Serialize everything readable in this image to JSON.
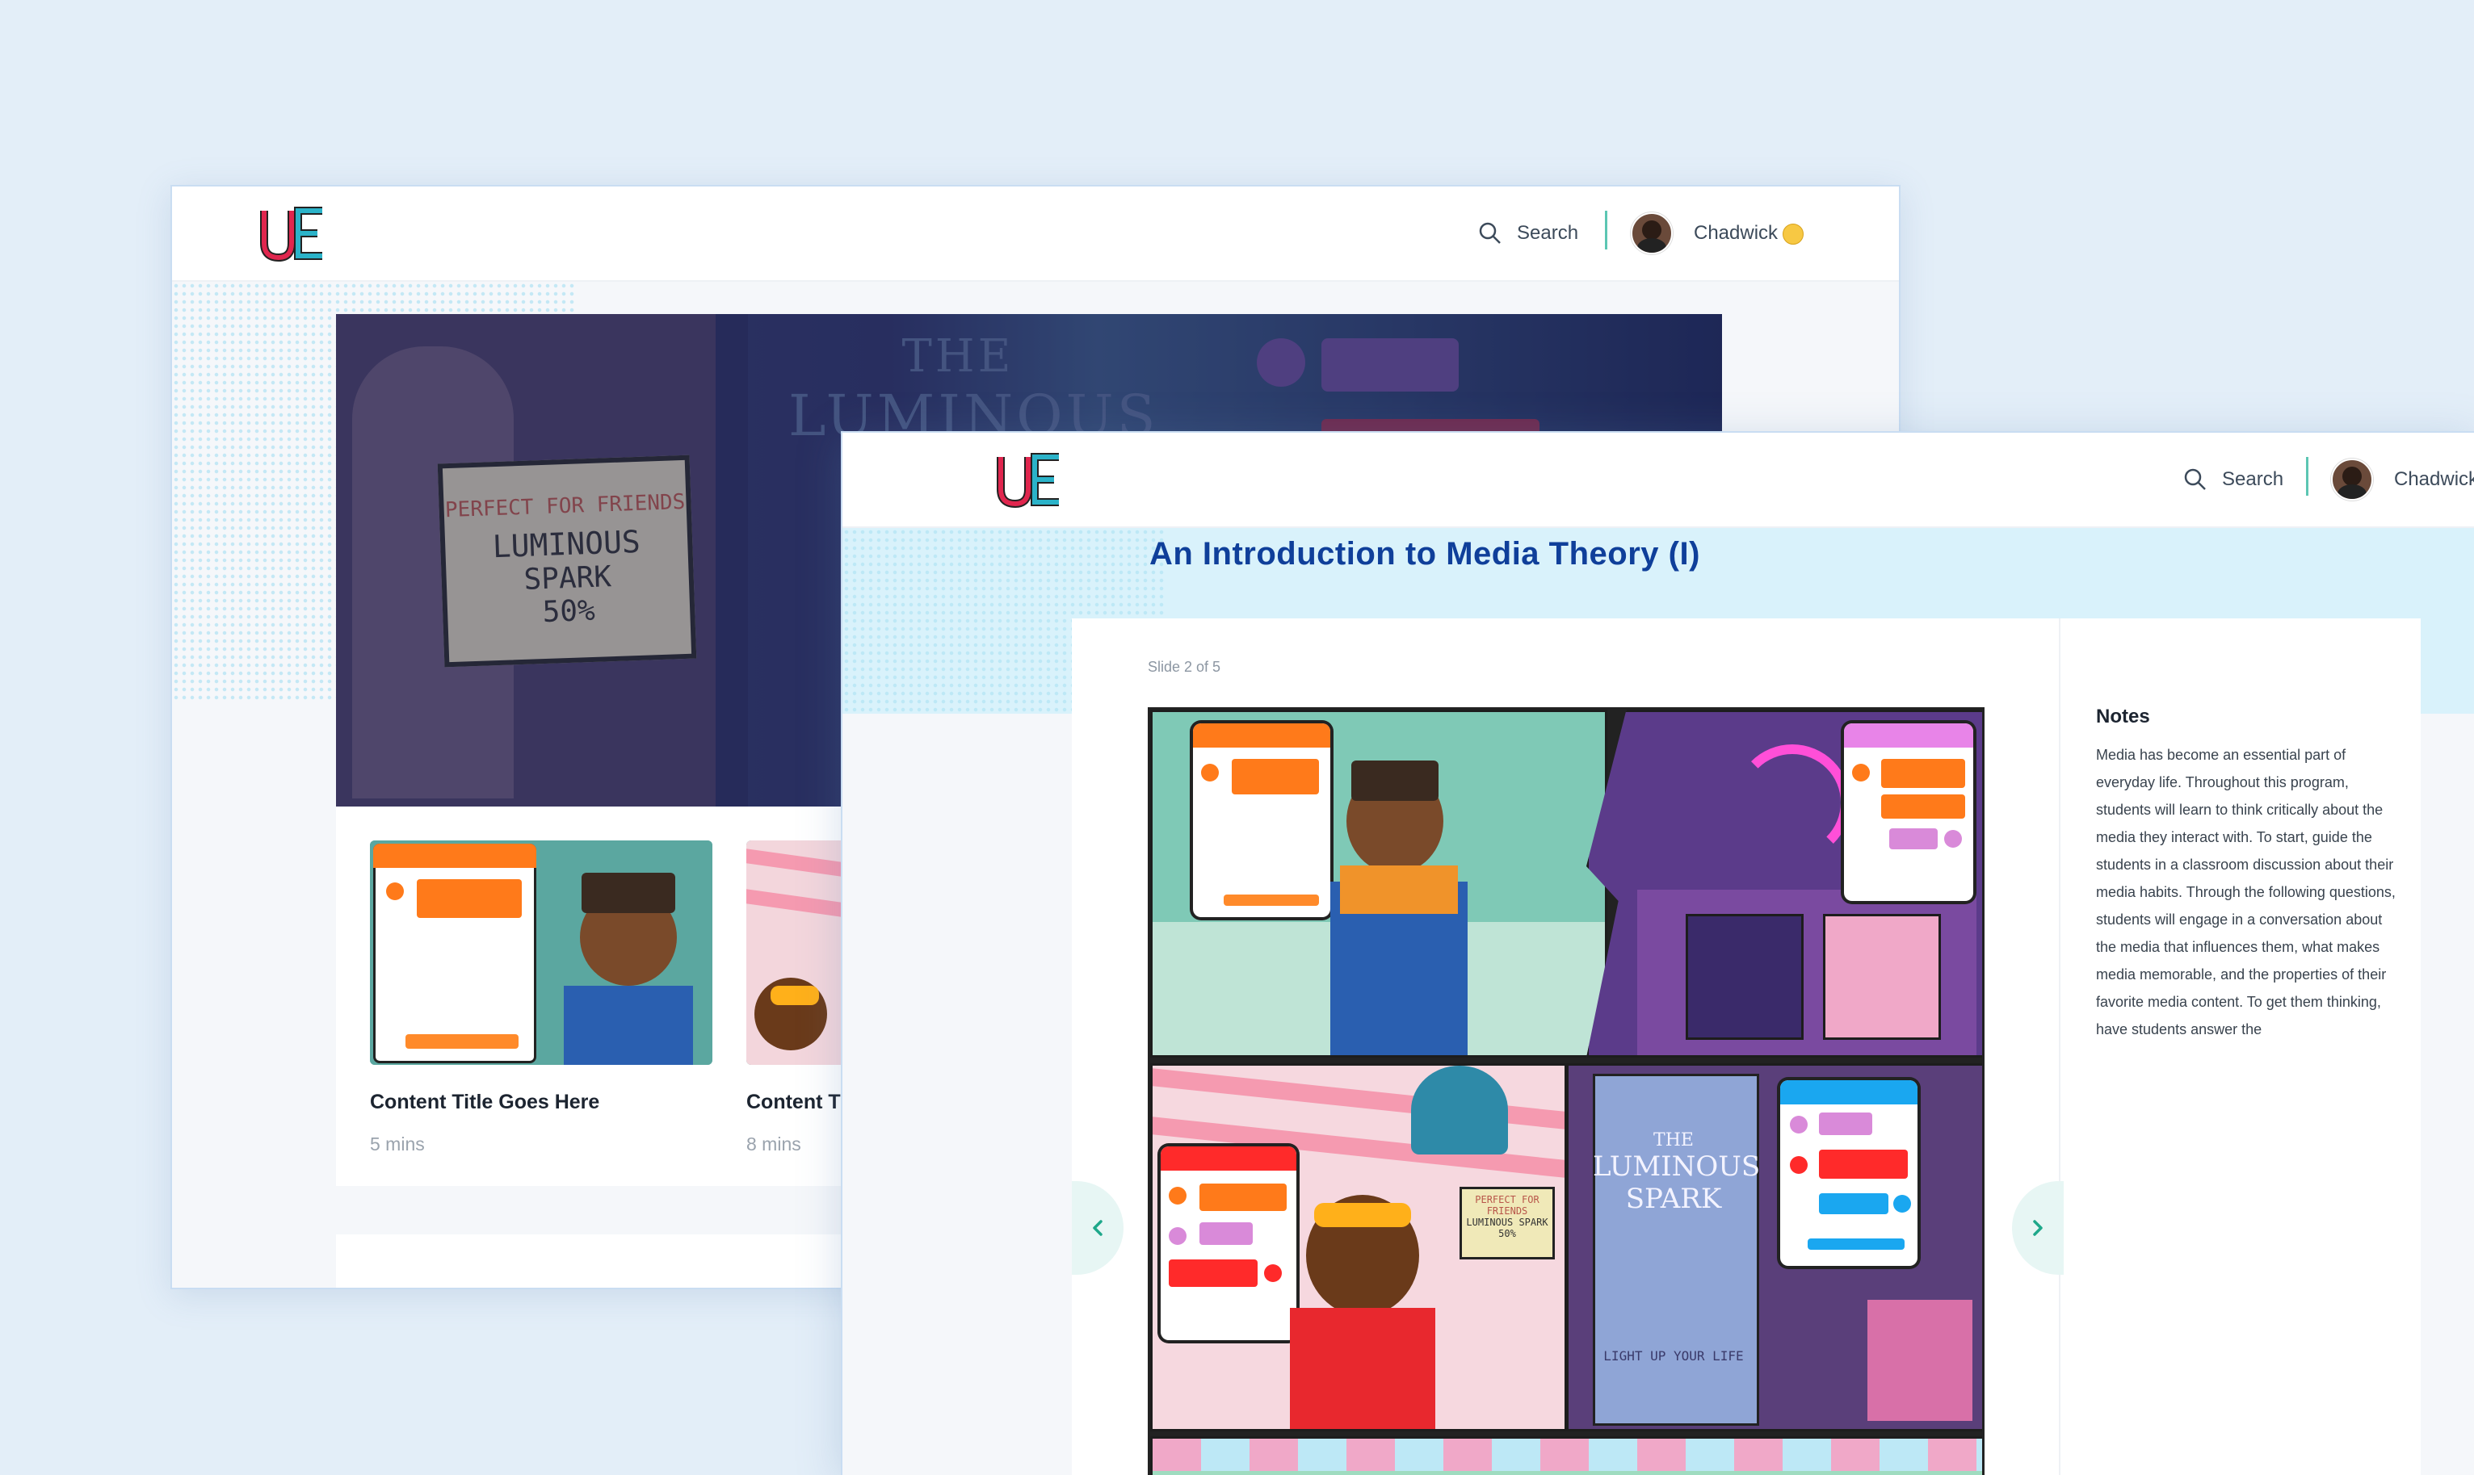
{
  "colors": {
    "background": "#e3eef8",
    "accent_teal": "#5cc6b3",
    "title_blue": "#0f3f9a",
    "logo_red": "#e0264e",
    "logo_teal": "#2bb3c9"
  },
  "back_window": {
    "logo_icon": "ue-logo-icon",
    "search_label": "Search",
    "user_name": "Chadwick",
    "hero": {
      "sign_line1": "PERFECT FOR FRIENDS",
      "sign_line2": "LUMINOUS",
      "sign_line3": "SPARK",
      "sign_line4": "50%",
      "poster_line1": "THE",
      "poster_line2": "LUMINOUS"
    },
    "cards": [
      {
        "title": "Content Title Goes Here",
        "meta": "5 mins"
      },
      {
        "title": "Content Title Goes Here",
        "meta": "8 mins"
      }
    ]
  },
  "front_window": {
    "logo_icon": "ue-logo-icon",
    "search_label": "Search",
    "user_name": "Chadwick",
    "page_title": "An Introduction to Media Theory (I)",
    "slide_counter": "Slide 2 of 5",
    "prev_icon": "chevron-left-icon",
    "next_icon": "chevron-right-icon",
    "comic_text": {
      "poster_line1": "THE",
      "poster_line2": "LUMINOUS",
      "poster_line3": "SPARK",
      "poster_line4": "LIGHT UP YOUR LIFE",
      "sign_line1": "PERFECT FOR FRIENDS",
      "sign_line2": "LUMINOUS SPARK",
      "sign_line3": "50%"
    },
    "notes": {
      "title": "Notes",
      "body": "Media has become an essential part of everyday life. Throughout this program, students will learn to think critically about the media they interact with. To start, guide the students in a classroom discussion about their media habits. Through the following questions, students will engage in a conversation about the media that influences them, what makes media memorable, and the properties of their favorite media content. To get them thinking, have students answer the"
    }
  }
}
